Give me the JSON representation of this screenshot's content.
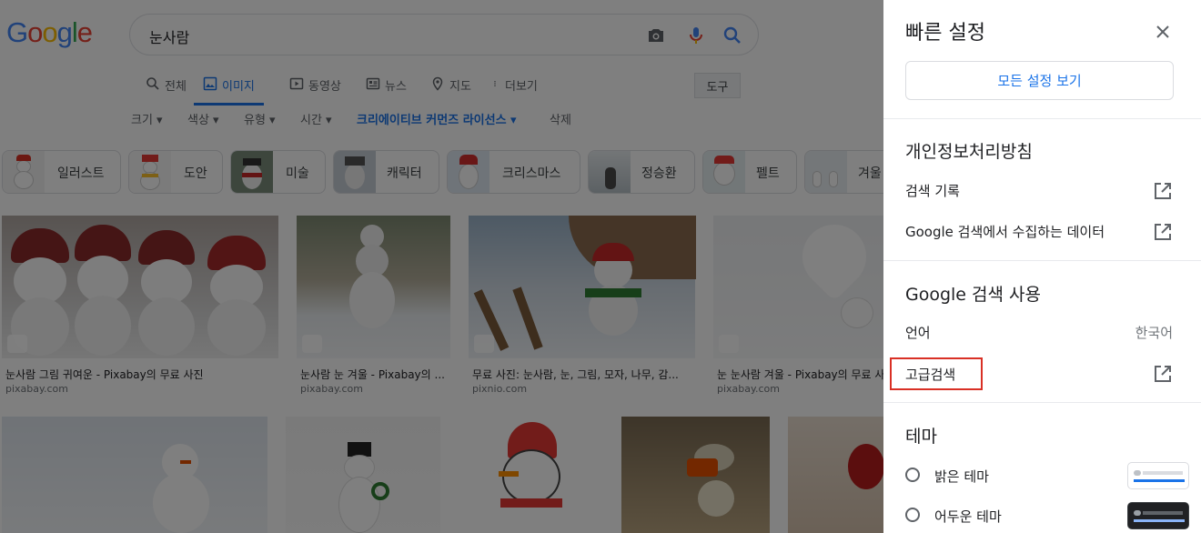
{
  "logo": "Google",
  "search": {
    "query": "눈사람"
  },
  "tabs": [
    {
      "label": "전체",
      "icon": "search-icon"
    },
    {
      "label": "이미지",
      "icon": "image-icon",
      "active": true
    },
    {
      "label": "동영상",
      "icon": "play-icon"
    },
    {
      "label": "뉴스",
      "icon": "news-icon"
    },
    {
      "label": "지도",
      "icon": "pin-icon"
    },
    {
      "label": "더보기",
      "icon": "more-vert-icon"
    }
  ],
  "tools_label": "도구",
  "filters": [
    {
      "label": "크기 ▾"
    },
    {
      "label": "색상 ▾"
    },
    {
      "label": "유형 ▾"
    },
    {
      "label": "시간 ▾"
    },
    {
      "label": "크리에이티브 커먼즈 라이선스 ▾",
      "bold": true
    },
    {
      "label": "삭제"
    }
  ],
  "chips": [
    {
      "label": "일러스트"
    },
    {
      "label": "도안"
    },
    {
      "label": "미술"
    },
    {
      "label": "캐릭터"
    },
    {
      "label": "크리스마스"
    },
    {
      "label": "정승환"
    },
    {
      "label": "펠트"
    },
    {
      "label": "겨울"
    }
  ],
  "results": [
    {
      "caption": "눈사람 그림 귀여운 - Pixabay의 무료 사진",
      "source": "pixabay.com"
    },
    {
      "caption": "눈사람 눈 겨울 - Pixabay의 ...",
      "source": "pixabay.com"
    },
    {
      "caption": "무료 사진: 눈사람, 눈, 그림, 모자, 나무, 감...",
      "source": "pixnio.com"
    },
    {
      "caption": "눈 눈사람 겨울 - Pixabay의 무료 사진",
      "source": "pixabay.com"
    }
  ],
  "panel": {
    "title": "빠른 설정",
    "all_settings": "모든 설정 보기",
    "privacy_title": "개인정보처리방침",
    "search_history": "검색 기록",
    "collected_data": "Google 검색에서 수집하는 데이터",
    "usage_title": "Google 검색 사용",
    "language_label": "언어",
    "language_value": "한국어",
    "advanced_search": "고급검색",
    "theme_title": "테마",
    "light_theme": "밝은 테마",
    "dark_theme": "어두운 테마"
  },
  "colors": {
    "accent": "#1a73e8",
    "highlight": "#d93025",
    "overlay": "rgba(0,0,0,0.5)"
  }
}
